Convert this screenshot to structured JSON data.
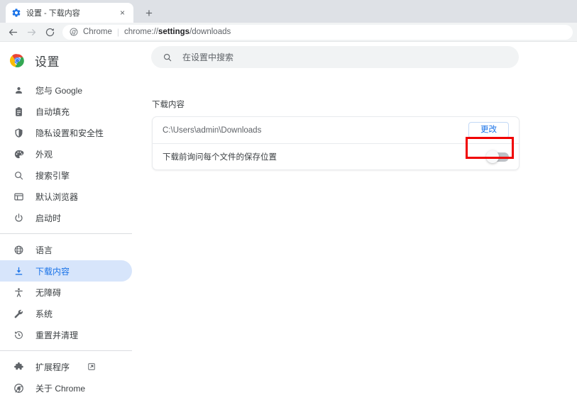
{
  "browser": {
    "tab": {
      "title": "设置 - 下载内容",
      "favicon": "gear-icon",
      "close_label": "×"
    },
    "new_tab_label": "+",
    "nav": {
      "back": "←",
      "forward": "→",
      "reload": "⟳"
    },
    "omnibox": {
      "chip_label": "Chrome",
      "separator": "|",
      "url_prefix": "chrome://",
      "url_bold": "settings",
      "url_suffix": "/downloads"
    }
  },
  "sidebar": {
    "brand_title": "设置",
    "brand_logo": "chrome-logo-icon",
    "groups": [
      {
        "items": [
          {
            "label": "您与 Google",
            "icon": "person-icon",
            "selected": false
          },
          {
            "label": "自动填充",
            "icon": "clipboard-icon",
            "selected": false
          },
          {
            "label": "隐私设置和安全性",
            "icon": "shield-icon",
            "selected": false
          },
          {
            "label": "外观",
            "icon": "palette-icon",
            "selected": false
          },
          {
            "label": "搜索引擎",
            "icon": "search-icon",
            "selected": false
          },
          {
            "label": "默认浏览器",
            "icon": "browser-window-icon",
            "selected": false
          },
          {
            "label": "启动时",
            "icon": "power-icon",
            "selected": false
          }
        ]
      },
      {
        "items": [
          {
            "label": "语言",
            "icon": "globe-icon",
            "selected": false
          },
          {
            "label": "下载内容",
            "icon": "download-icon",
            "selected": true
          },
          {
            "label": "无障碍",
            "icon": "accessibility-icon",
            "selected": false
          },
          {
            "label": "系统",
            "icon": "wrench-icon",
            "selected": false
          },
          {
            "label": "重置并清理",
            "icon": "restore-icon",
            "selected": false
          }
        ]
      },
      {
        "items": [
          {
            "label": "扩展程序",
            "icon": "puzzle-icon",
            "selected": false,
            "external": true
          },
          {
            "label": "关于 Chrome",
            "icon": "chrome-logo-icon",
            "selected": false
          }
        ]
      }
    ]
  },
  "main": {
    "search": {
      "placeholder": "在设置中搜索",
      "icon": "search-icon"
    },
    "section_title": "下载内容",
    "location_row": {
      "path": "C:\\Users\\admin\\Downloads",
      "change_button": "更改"
    },
    "ask_row": {
      "label": "下载前询问每个文件的保存位置",
      "toggle_state": "off"
    }
  },
  "colors": {
    "accent": "#1a73e8",
    "selected_pill": "#d7e5fb",
    "highlight": "#f00000",
    "toggle_off_track": "#bdc1c6"
  }
}
